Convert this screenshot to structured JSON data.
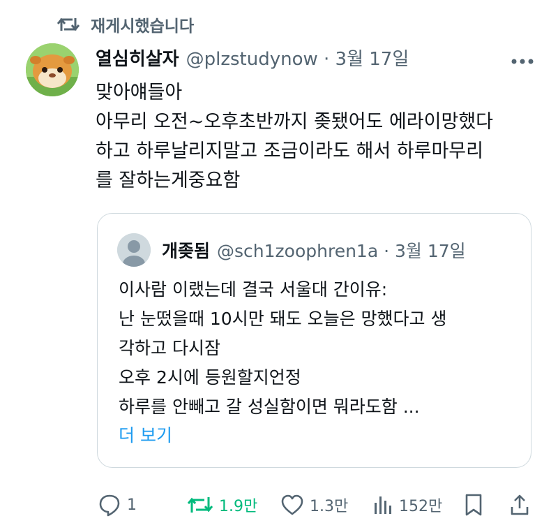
{
  "retweet_banner": {
    "label": "재게시했습니다"
  },
  "tweet": {
    "author_name": "열심히살자",
    "meta": "@plzstudynow · 3월 17일",
    "lines": [
      "맞아얘들아",
      "아무리 오전~오후초반까지 좆됐어도 에라이망했다",
      "하고 하루날리지말고 조금이라도 해서 하루마무리",
      "를 잘하는게중요함"
    ]
  },
  "quote": {
    "author_name": "개좆됨",
    "meta": "@sch1zoophren1a · 3월 17일",
    "lines": [
      "이사람 이랬는데 결국 서울대 간이유:",
      "난 눈떴을때 10시만 돼도 오늘은 망했다고 생",
      "각하고 다시잠",
      "오후 2시에 등원할지언정",
      "하루를 안빼고 갈 성실함이면 뭐라도함 ..."
    ],
    "show_more": "더 보기"
  },
  "actions": {
    "reply_count": "1",
    "repost_count": "1.9만",
    "like_count": "1.3만",
    "view_count": "152만"
  },
  "colors": {
    "accent": "#1d9bf0",
    "repost_active": "#00ba7c",
    "secondary_text": "#536471",
    "border": "#cfd9de"
  },
  "icons": [
    "repost-icon",
    "more-icon",
    "reply-icon",
    "like-icon",
    "views-icon",
    "bookmark-icon",
    "share-icon"
  ]
}
